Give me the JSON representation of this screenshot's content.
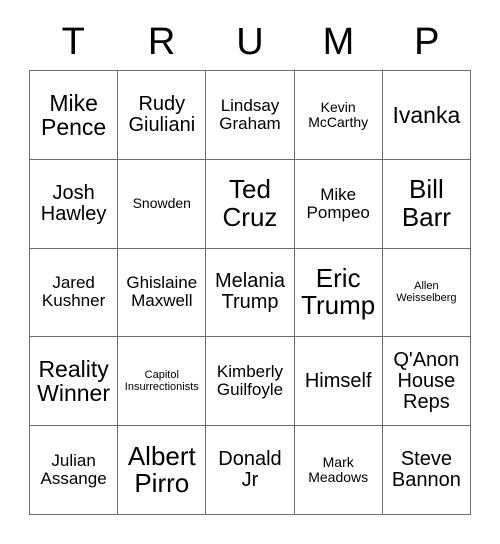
{
  "card": {
    "header_letters": [
      "T",
      "R",
      "U",
      "M",
      "P"
    ],
    "rows": [
      [
        {
          "text": "Mike Pence",
          "size": "xl"
        },
        {
          "text": "Rudy Giuliani",
          "size": "lg"
        },
        {
          "text": "Lindsay Graham",
          "size": "md"
        },
        {
          "text": "Kevin McCarthy",
          "size": "sm"
        },
        {
          "text": "Ivanka",
          "size": "xl"
        }
      ],
      [
        {
          "text": "Josh Hawley",
          "size": "lg"
        },
        {
          "text": "Snowden",
          "size": "sm"
        },
        {
          "text": "Ted Cruz",
          "size": "xxl"
        },
        {
          "text": "Mike Pompeo",
          "size": "md"
        },
        {
          "text": "Bill Barr",
          "size": "xxl"
        }
      ],
      [
        {
          "text": "Jared Kushner",
          "size": "md"
        },
        {
          "text": "Ghislaine Maxwell",
          "size": "md"
        },
        {
          "text": "Melania Trump",
          "size": "lg"
        },
        {
          "text": "Eric Trump",
          "size": "xxl"
        },
        {
          "text": "Allen Weisselberg",
          "size": "xs"
        }
      ],
      [
        {
          "text": "Reality Winner",
          "size": "xl"
        },
        {
          "text": "Capitol Insurrectionists",
          "size": "xs"
        },
        {
          "text": "Kimberly Guilfoyle",
          "size": "md"
        },
        {
          "text": "Himself",
          "size": "lg"
        },
        {
          "text": "Q'Anon House Reps",
          "size": "lg"
        }
      ],
      [
        {
          "text": "Julian Assange",
          "size": "md"
        },
        {
          "text": "Albert Pirro",
          "size": "xxl"
        },
        {
          "text": "Donald Jr",
          "size": "lg"
        },
        {
          "text": "Mark Meadows",
          "size": "sm"
        },
        {
          "text": "Steve Bannon",
          "size": "lg"
        }
      ]
    ]
  },
  "colors": {
    "grid_line": "#6e6e6e",
    "text": "#000000",
    "background": "#ffffff"
  }
}
